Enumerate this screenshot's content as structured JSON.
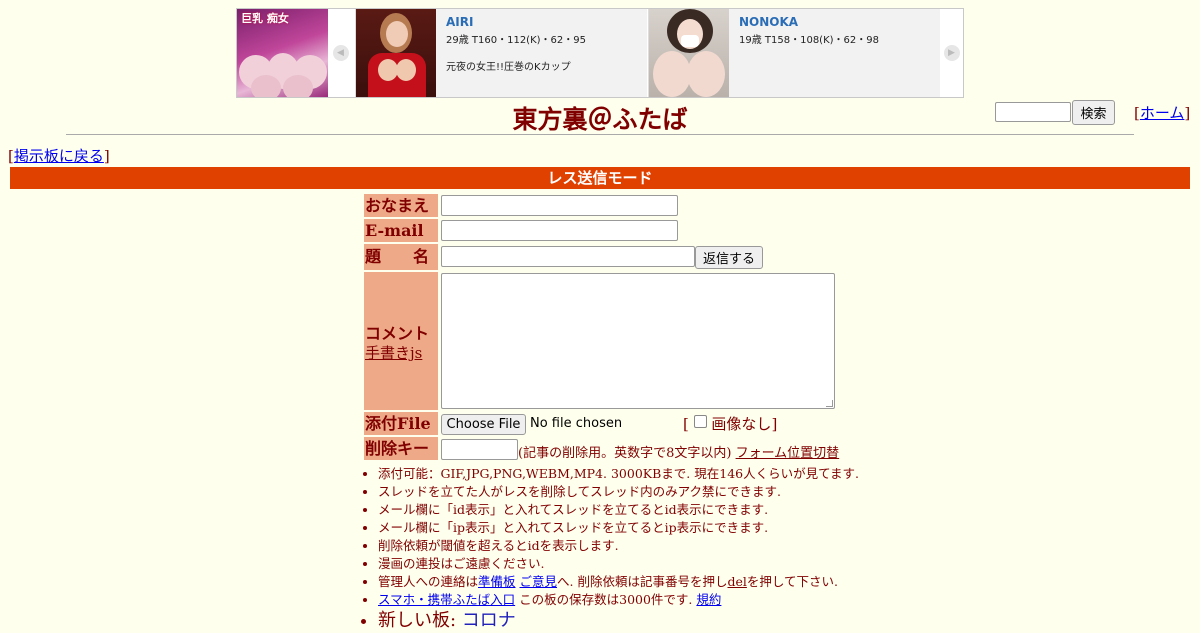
{
  "ad": {
    "logo_text": "巨乳 痴女",
    "cards": [
      {
        "name": "AIRI",
        "stats": "29歳 T160・112(K)・62・95",
        "desc": "元夜の女王!!圧巻のKカップ"
      },
      {
        "name": "NONOKA",
        "stats": "19歳 T158・108(K)・62・98",
        "desc": ""
      }
    ]
  },
  "header": {
    "title": "東方裏＠ふたば",
    "search_button": "検索",
    "home_prefix": "[",
    "home_link": "ホーム",
    "home_suffix": "]"
  },
  "back": {
    "prefix": "[",
    "link": "掲示板に戻る",
    "suffix": "]"
  },
  "mode_title": "レス送信モード",
  "form": {
    "name_label": "おなまえ",
    "email_label": "E-mail",
    "subject_label": "題　　名",
    "submit_button": "返信する",
    "comment_label": "コメント",
    "draw_link": "手書きjs",
    "file_label": "添付File",
    "choose_file": "Choose File",
    "no_file": "No file chosen",
    "noimage_prefix": "[",
    "noimage_label": "画像なし",
    "noimage_suffix": "]",
    "delkey_label": "削除キー",
    "delkey_note": "(記事の削除用。英数字で8文字以内)",
    "form_toggle": "フォーム位置切替"
  },
  "notes": {
    "n1": "添付可能：GIF,JPG,PNG,WEBM,MP4. 3000KBまで. 現在146人くらいが見てます.",
    "n2": "スレッドを立てた人がレスを削除してスレッド内のみアク禁にできます.",
    "n3": "メール欄に「id表示」と入れてスレッドを立てるとid表示にできます.",
    "n4": "メール欄に「ip表示」と入れてスレッドを立てるとip表示にできます.",
    "n5": "削除依頼が閾値を超えるとidを表示します.",
    "n6": "漫画の連投はご遠慮ください.",
    "n7_a": "管理人への連絡は",
    "n7_link1": "準備板",
    "n7_link2": "ご意見",
    "n7_b": "へ. 削除依頼は記事番号を押し",
    "n7_del": "del",
    "n7_c": "を押して下さい.",
    "n8_link": "スマホ・携帯ふたば入口",
    "n8_text": " この板の保存数は3000件です.",
    "n8_rules": "規約",
    "n9_prefix": "新しい板: ",
    "n9_link": "コロナ"
  }
}
